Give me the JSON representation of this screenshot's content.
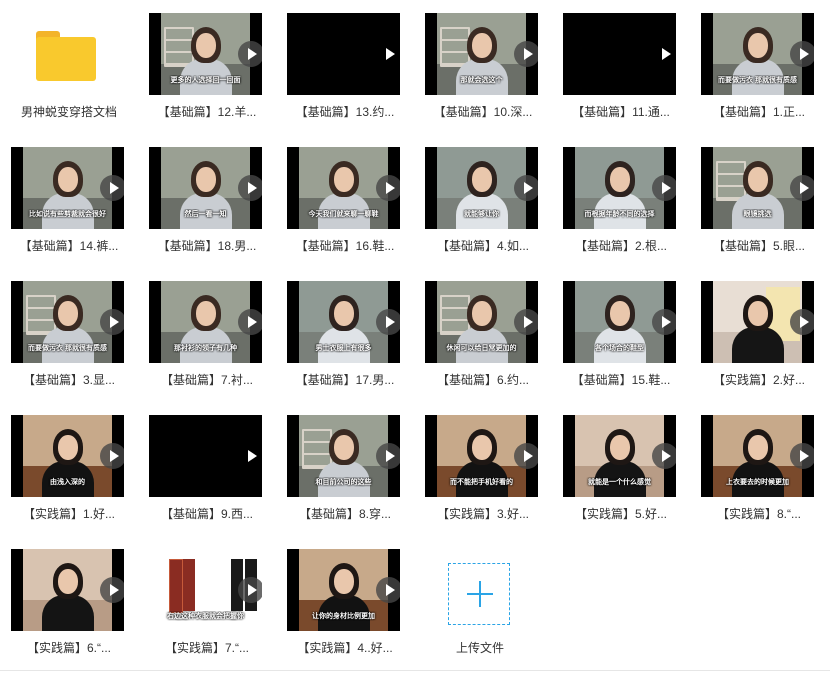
{
  "folder": {
    "label": "男神蜕变穿搭文档",
    "icon": "folder-icon"
  },
  "files": [
    {
      "label": "【基础篇】12.羊...",
      "thumb": "studio",
      "caption": "更多的人选择回一回面",
      "shelf": true
    },
    {
      "label": "【基础篇】13.约...",
      "thumb": "blank"
    },
    {
      "label": "【基础篇】10.深...",
      "thumb": "studio",
      "caption": "那就会选这个",
      "shelf": true
    },
    {
      "label": "【基础篇】11.通...",
      "thumb": "blank"
    },
    {
      "label": "【基础篇】1.正...",
      "thumb": "studio",
      "caption": "而要做污衣 那就很有质感",
      "shelf": false
    },
    {
      "label": "【基础篇】14.裤...",
      "thumb": "studio",
      "caption": "比如说有些剪裁就会很好"
    },
    {
      "label": "【基础篇】18.男...",
      "thumb": "studio",
      "caption": "然后一看一知"
    },
    {
      "label": "【基础篇】16.鞋...",
      "thumb": "studio",
      "caption": "今天我们就来聊一聊鞋"
    },
    {
      "label": "【基础篇】4.如...",
      "thumb": "closeup",
      "caption": "就能够让你"
    },
    {
      "label": "【基础篇】2.根...",
      "thumb": "closeup",
      "caption": "而根据年龄不同的选择"
    },
    {
      "label": "【基础篇】5.眼...",
      "thumb": "studio",
      "caption": "眼镜挑选",
      "shelf": true
    },
    {
      "label": "【基础篇】3.显...",
      "thumb": "studio",
      "caption": "而要做污衣 那就很有质感",
      "shelf": true
    },
    {
      "label": "【基础篇】7.衬...",
      "thumb": "studio",
      "caption": "那衬衫的领子有几种"
    },
    {
      "label": "【基础篇】17.男...",
      "thumb": "closeup",
      "caption": "男士衣服上有很多"
    },
    {
      "label": "【基础篇】6.约...",
      "thumb": "studio",
      "caption": "休闲可以给日常更加的",
      "shelf": true
    },
    {
      "label": "【基础篇】15.鞋...",
      "thumb": "closeup",
      "caption": "各个场合的鞋型"
    },
    {
      "label": "【实践篇】2.好...",
      "thumb": "practice-board",
      "caption": ""
    },
    {
      "label": "【实践篇】1.好...",
      "thumb": "practice",
      "caption": "由浅入深的"
    },
    {
      "label": "【基础篇】9.西...",
      "thumb": "blank"
    },
    {
      "label": "【基础篇】8.穿...",
      "thumb": "studio",
      "caption": "和目前公司的这些",
      "shelf": true
    },
    {
      "label": "【实践篇】3.好...",
      "thumb": "practice",
      "caption": "而不能把手机好看的"
    },
    {
      "label": "【实践篇】5.好...",
      "thumb": "practice-close",
      "caption": "就能是一个什么感觉"
    },
    {
      "label": "【实践篇】8.“...",
      "thumb": "practice",
      "caption": "上衣要去的时候更加"
    },
    {
      "label": "【实践篇】6.“...",
      "thumb": "practice-close",
      "caption": ""
    },
    {
      "label": "【实践篇】7.“...",
      "thumb": "clothes",
      "caption": "右边这种衣服就会把握你"
    },
    {
      "label": "【实践篇】4..好...",
      "thumb": "practice",
      "caption": "让你的身材比例更加"
    }
  ],
  "upload": {
    "label": "上传文件",
    "icon": "plus-icon"
  },
  "colors": {
    "folder": "#f9c92d",
    "accent": "#2aa4e6",
    "text": "#333333"
  }
}
